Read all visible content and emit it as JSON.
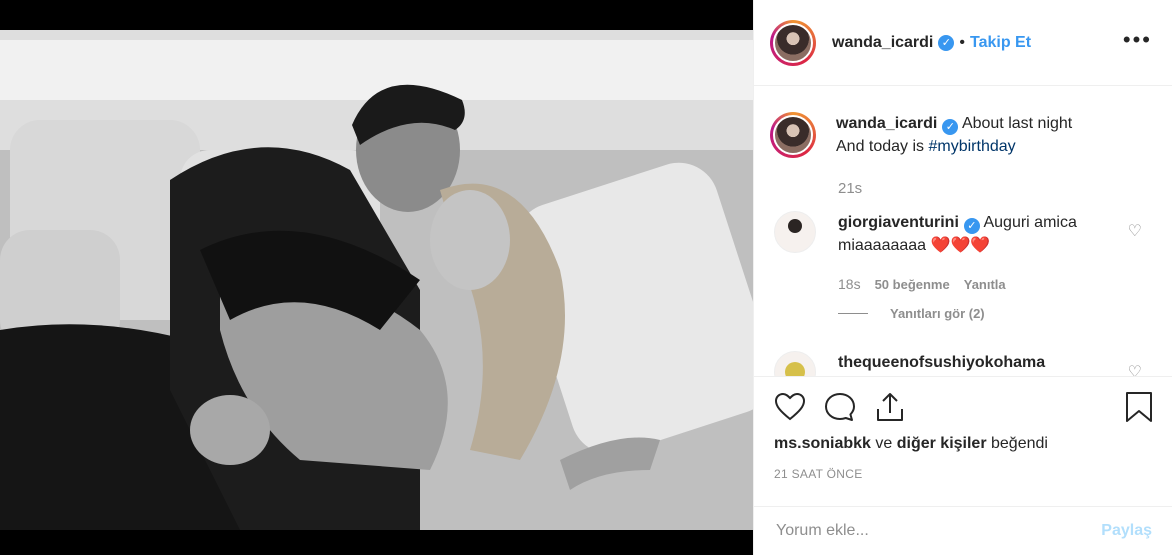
{
  "post": {
    "author": "wanda_icardi",
    "follow_label": "Takip Et",
    "separator": "•",
    "more_label": "•••"
  },
  "caption": {
    "username": "wanda_icardi",
    "text_line1": "About last night",
    "text_line2_prefix": "And today is ",
    "hashtag": "#mybirthday",
    "time": "21s"
  },
  "comments": [
    {
      "username": "giorgiaventurini",
      "text": "Auguri amica miaaaaaaaa",
      "hearts": "❤️❤️❤️",
      "time": "18s",
      "likes": "50 beğenme",
      "reply_label": "Yanıtla",
      "view_replies": "Yanıtları gör (2)"
    },
    {
      "username": "thequeenofsushiyokohama"
    }
  ],
  "actions": {
    "liked_by_user": "ms.soniabkk",
    "liked_connector": " ve ",
    "liked_others": "diğer kişiler",
    "liked_suffix": " beğendi",
    "timestamp": "21 SAAT ÖNCE"
  },
  "add_comment": {
    "placeholder": "Yorum ekle...",
    "post_label": "Paylaş"
  },
  "colors": {
    "accent": "#3897f0",
    "post_disabled": "#b2dffc",
    "heart": "#e0192b"
  },
  "icons": [
    "heart-icon",
    "comment-icon",
    "share-icon",
    "bookmark-icon",
    "more-icon",
    "verified-badge-icon"
  ]
}
